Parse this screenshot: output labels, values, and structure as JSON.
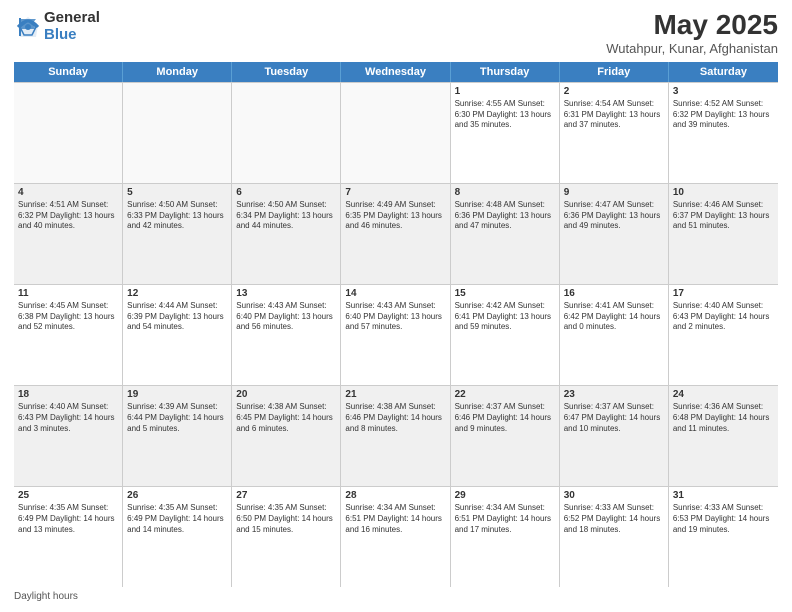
{
  "header": {
    "logo_general": "General",
    "logo_blue": "Blue",
    "main_title": "May 2025",
    "subtitle": "Wutahpur, Kunar, Afghanistan"
  },
  "days_of_week": [
    "Sunday",
    "Monday",
    "Tuesday",
    "Wednesday",
    "Thursday",
    "Friday",
    "Saturday"
  ],
  "footer": {
    "daylight_label": "Daylight hours"
  },
  "weeks": [
    {
      "cells": [
        {
          "day": "",
          "text": "",
          "empty": true
        },
        {
          "day": "",
          "text": "",
          "empty": true
        },
        {
          "day": "",
          "text": "",
          "empty": true
        },
        {
          "day": "",
          "text": "",
          "empty": true
        },
        {
          "day": "1",
          "text": "Sunrise: 4:55 AM\nSunset: 6:30 PM\nDaylight: 13 hours\nand 35 minutes."
        },
        {
          "day": "2",
          "text": "Sunrise: 4:54 AM\nSunset: 6:31 PM\nDaylight: 13 hours\nand 37 minutes."
        },
        {
          "day": "3",
          "text": "Sunrise: 4:52 AM\nSunset: 6:32 PM\nDaylight: 13 hours\nand 39 minutes."
        }
      ]
    },
    {
      "cells": [
        {
          "day": "4",
          "text": "Sunrise: 4:51 AM\nSunset: 6:32 PM\nDaylight: 13 hours\nand 40 minutes."
        },
        {
          "day": "5",
          "text": "Sunrise: 4:50 AM\nSunset: 6:33 PM\nDaylight: 13 hours\nand 42 minutes."
        },
        {
          "day": "6",
          "text": "Sunrise: 4:50 AM\nSunset: 6:34 PM\nDaylight: 13 hours\nand 44 minutes."
        },
        {
          "day": "7",
          "text": "Sunrise: 4:49 AM\nSunset: 6:35 PM\nDaylight: 13 hours\nand 46 minutes."
        },
        {
          "day": "8",
          "text": "Sunrise: 4:48 AM\nSunset: 6:36 PM\nDaylight: 13 hours\nand 47 minutes."
        },
        {
          "day": "9",
          "text": "Sunrise: 4:47 AM\nSunset: 6:36 PM\nDaylight: 13 hours\nand 49 minutes."
        },
        {
          "day": "10",
          "text": "Sunrise: 4:46 AM\nSunset: 6:37 PM\nDaylight: 13 hours\nand 51 minutes."
        }
      ]
    },
    {
      "cells": [
        {
          "day": "11",
          "text": "Sunrise: 4:45 AM\nSunset: 6:38 PM\nDaylight: 13 hours\nand 52 minutes."
        },
        {
          "day": "12",
          "text": "Sunrise: 4:44 AM\nSunset: 6:39 PM\nDaylight: 13 hours\nand 54 minutes."
        },
        {
          "day": "13",
          "text": "Sunrise: 4:43 AM\nSunset: 6:40 PM\nDaylight: 13 hours\nand 56 minutes."
        },
        {
          "day": "14",
          "text": "Sunrise: 4:43 AM\nSunset: 6:40 PM\nDaylight: 13 hours\nand 57 minutes."
        },
        {
          "day": "15",
          "text": "Sunrise: 4:42 AM\nSunset: 6:41 PM\nDaylight: 13 hours\nand 59 minutes."
        },
        {
          "day": "16",
          "text": "Sunrise: 4:41 AM\nSunset: 6:42 PM\nDaylight: 14 hours\nand 0 minutes."
        },
        {
          "day": "17",
          "text": "Sunrise: 4:40 AM\nSunset: 6:43 PM\nDaylight: 14 hours\nand 2 minutes."
        }
      ]
    },
    {
      "cells": [
        {
          "day": "18",
          "text": "Sunrise: 4:40 AM\nSunset: 6:43 PM\nDaylight: 14 hours\nand 3 minutes."
        },
        {
          "day": "19",
          "text": "Sunrise: 4:39 AM\nSunset: 6:44 PM\nDaylight: 14 hours\nand 5 minutes."
        },
        {
          "day": "20",
          "text": "Sunrise: 4:38 AM\nSunset: 6:45 PM\nDaylight: 14 hours\nand 6 minutes."
        },
        {
          "day": "21",
          "text": "Sunrise: 4:38 AM\nSunset: 6:46 PM\nDaylight: 14 hours\nand 8 minutes."
        },
        {
          "day": "22",
          "text": "Sunrise: 4:37 AM\nSunset: 6:46 PM\nDaylight: 14 hours\nand 9 minutes."
        },
        {
          "day": "23",
          "text": "Sunrise: 4:37 AM\nSunset: 6:47 PM\nDaylight: 14 hours\nand 10 minutes."
        },
        {
          "day": "24",
          "text": "Sunrise: 4:36 AM\nSunset: 6:48 PM\nDaylight: 14 hours\nand 11 minutes."
        }
      ]
    },
    {
      "cells": [
        {
          "day": "25",
          "text": "Sunrise: 4:35 AM\nSunset: 6:49 PM\nDaylight: 14 hours\nand 13 minutes."
        },
        {
          "day": "26",
          "text": "Sunrise: 4:35 AM\nSunset: 6:49 PM\nDaylight: 14 hours\nand 14 minutes."
        },
        {
          "day": "27",
          "text": "Sunrise: 4:35 AM\nSunset: 6:50 PM\nDaylight: 14 hours\nand 15 minutes."
        },
        {
          "day": "28",
          "text": "Sunrise: 4:34 AM\nSunset: 6:51 PM\nDaylight: 14 hours\nand 16 minutes."
        },
        {
          "day": "29",
          "text": "Sunrise: 4:34 AM\nSunset: 6:51 PM\nDaylight: 14 hours\nand 17 minutes."
        },
        {
          "day": "30",
          "text": "Sunrise: 4:33 AM\nSunset: 6:52 PM\nDaylight: 14 hours\nand 18 minutes."
        },
        {
          "day": "31",
          "text": "Sunrise: 4:33 AM\nSunset: 6:53 PM\nDaylight: 14 hours\nand 19 minutes."
        }
      ]
    }
  ]
}
